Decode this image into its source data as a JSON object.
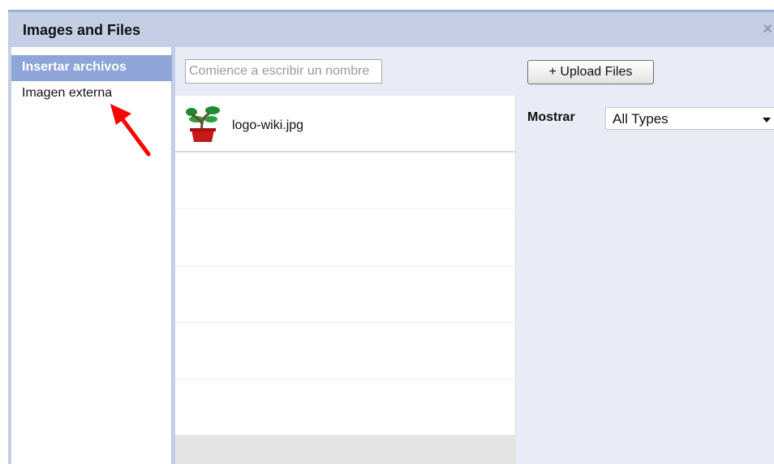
{
  "dialog": {
    "title": "Images and Files",
    "close_glyph": "×"
  },
  "sidebar": {
    "items": [
      {
        "label": "Insertar archivos",
        "active": true
      },
      {
        "label": "Imagen externa",
        "active": false
      }
    ]
  },
  "toolbar": {
    "search_placeholder": "Comience a escribir un nombre",
    "upload_label": "+ Upload Files"
  },
  "files": [
    {
      "name": "logo-wiki.jpg",
      "thumb_icon": "potted-bonsai-thumbnail"
    }
  ],
  "filter": {
    "label": "Mostrar",
    "selected": "All Types"
  },
  "annotation": {
    "arrow_color": "#ff0000"
  },
  "colors": {
    "titlebar": "#c4cfe6",
    "active_item": "#8fa4d7",
    "panel": "#e8ecf7"
  }
}
